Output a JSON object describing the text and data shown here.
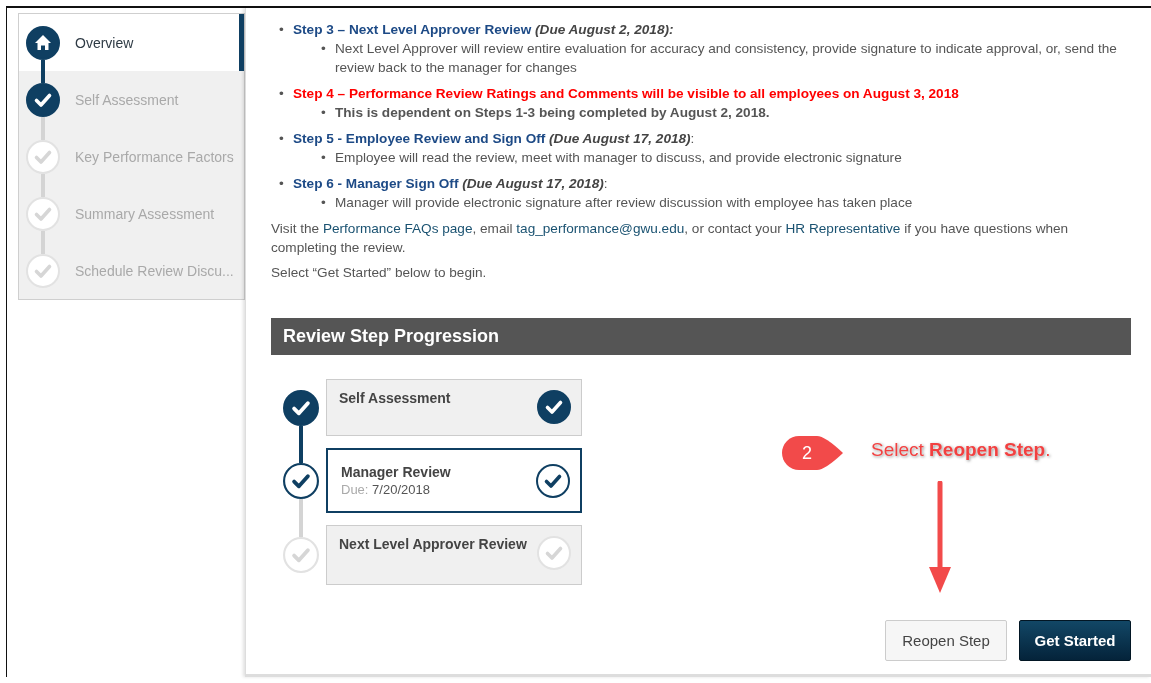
{
  "sidebar": {
    "items": [
      {
        "label": "Overview",
        "kind": "home",
        "completed": true,
        "selected": true
      },
      {
        "label": "Self Assessment",
        "kind": "step",
        "completed": true,
        "selected": false
      },
      {
        "label": "Key Performance Factors",
        "kind": "step",
        "completed": false,
        "selected": false
      },
      {
        "label": "Summary Assessment",
        "kind": "step",
        "completed": false,
        "selected": false
      },
      {
        "label": "Schedule Review Discu...",
        "kind": "step",
        "completed": false,
        "selected": false
      }
    ]
  },
  "instructions": {
    "steps": [
      {
        "bullet": "•",
        "title": "Step 3 – Next Level Approver Review",
        "due": "(Due August 2, 2018):",
        "urgent": false,
        "details": [
          {
            "bullet": "•",
            "text": "Next Level Approver will review entire evaluation for accuracy and consistency, provide signature to indicate approval, or, send the review back to the manager for changes"
          }
        ]
      },
      {
        "bullet": "•",
        "title": "Step 4 – Performance Review Ratings and Comments will be visible to all employees on August 3, 2018",
        "urgent": true,
        "details": [
          {
            "bullet": "•",
            "text": "This is dependent on Steps 1-3 being completed by August 2, 2018."
          }
        ]
      },
      {
        "bullet": "•",
        "title": "Step 5 - Employee Review and Sign Off",
        "due": "(Due August 17, 2018)",
        "suffix": ":",
        "urgent": false,
        "details": [
          {
            "bullet": "•",
            "text": "Employee will read the review, meet with manager to discuss, and provide electronic signature"
          }
        ]
      },
      {
        "bullet": "•",
        "title": "Step 6 - Manager Sign Off",
        "due": "(Due August 17, 2018)",
        "suffix": ":",
        "urgent": false,
        "details": [
          {
            "bullet": "•",
            "text": "Manager will provide electronic signature after review discussion with employee has taken place"
          }
        ]
      }
    ],
    "contact": [
      {
        "text": "Visit the "
      },
      {
        "text": "Performance FAQs page",
        "link": true
      },
      {
        "text": ", email "
      },
      {
        "text": "tag_performance@gwu.edu",
        "link": true
      },
      {
        "text": ", or contact your "
      },
      {
        "text": "HR Representative",
        "link": true
      },
      {
        "text": " if you have questions when completing the review."
      }
    ],
    "prompt": "Select “Get Started” below to begin."
  },
  "progression": {
    "title": "Review Step Progression",
    "steps": [
      {
        "name": "Self Assessment",
        "completed": true,
        "selected": false
      },
      {
        "name": "Manager Review",
        "completed": true,
        "selected": true,
        "due_label": "Due:",
        "due": "7/20/2018"
      },
      {
        "name": "Next Level Approver Review",
        "completed": false,
        "selected": false
      }
    ],
    "buttons": [
      {
        "label": "Reopen Step",
        "kind": "secondary"
      },
      {
        "label": "Get Started",
        "kind": "primary"
      }
    ]
  },
  "annotation": {
    "number": "2",
    "text": "Select **Reopen Step**."
  }
}
